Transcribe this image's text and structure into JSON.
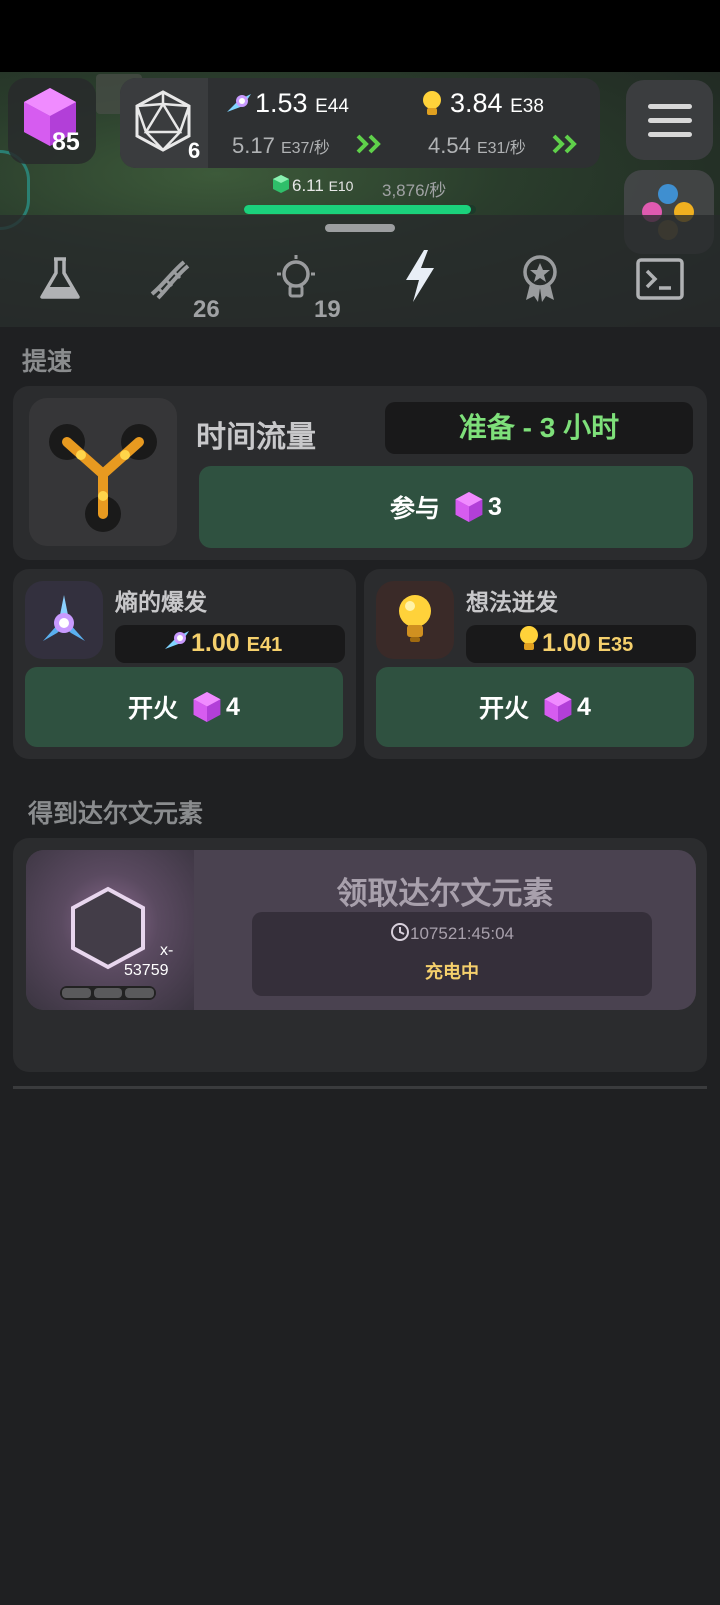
{
  "header": {
    "gem_count": "85",
    "complexity_count": "6",
    "entropy_value": "1.53",
    "entropy_exp": "E44",
    "entropy_rate_value": "5.17",
    "entropy_rate_exp": "E37/秒",
    "ideas_value": "3.84",
    "ideas_exp": "E38",
    "ideas_rate_value": "4.54",
    "ideas_rate_exp": "E31/秒",
    "progress_value": "6.11",
    "progress_exp": "E10",
    "progress_rate": "3,876/秒",
    "progress_fill": 0.98
  },
  "tabs": [
    {
      "icon": "flask-icon",
      "count": ""
    },
    {
      "icon": "dna-icon",
      "count": "26"
    },
    {
      "icon": "lightbulb-icon",
      "count": "19"
    },
    {
      "icon": "lightning-icon",
      "count": "",
      "active": true
    },
    {
      "icon": "medal-icon",
      "count": ""
    },
    {
      "icon": "terminal-icon",
      "count": ""
    }
  ],
  "boost": {
    "section_title": "提速",
    "time_flow": {
      "title": "时间流量",
      "status": "准备 - 3 小时",
      "button_label": "参与",
      "button_cost": "3"
    },
    "entropy_burst": {
      "title": "熵的爆发",
      "cost_value": "1.00",
      "cost_exp": "E41",
      "button_label": "开火",
      "button_cost": "4"
    },
    "idea_burst": {
      "title": "想法迸发",
      "cost_value": "1.00",
      "cost_exp": "E35",
      "button_label": "开火",
      "button_cost": "4"
    }
  },
  "darwin": {
    "section_title": "得到达尔文元素",
    "multiplier_prefix": "x-",
    "multiplier_value": "53759",
    "claim_title": "领取达尔文元素",
    "timer": "107521:45:04",
    "status": "充电中"
  },
  "colors": {
    "green_button": "#2f5140",
    "accent_green": "#1bd17c",
    "gold": "#f5d06c",
    "status_green": "#7ee07a"
  }
}
